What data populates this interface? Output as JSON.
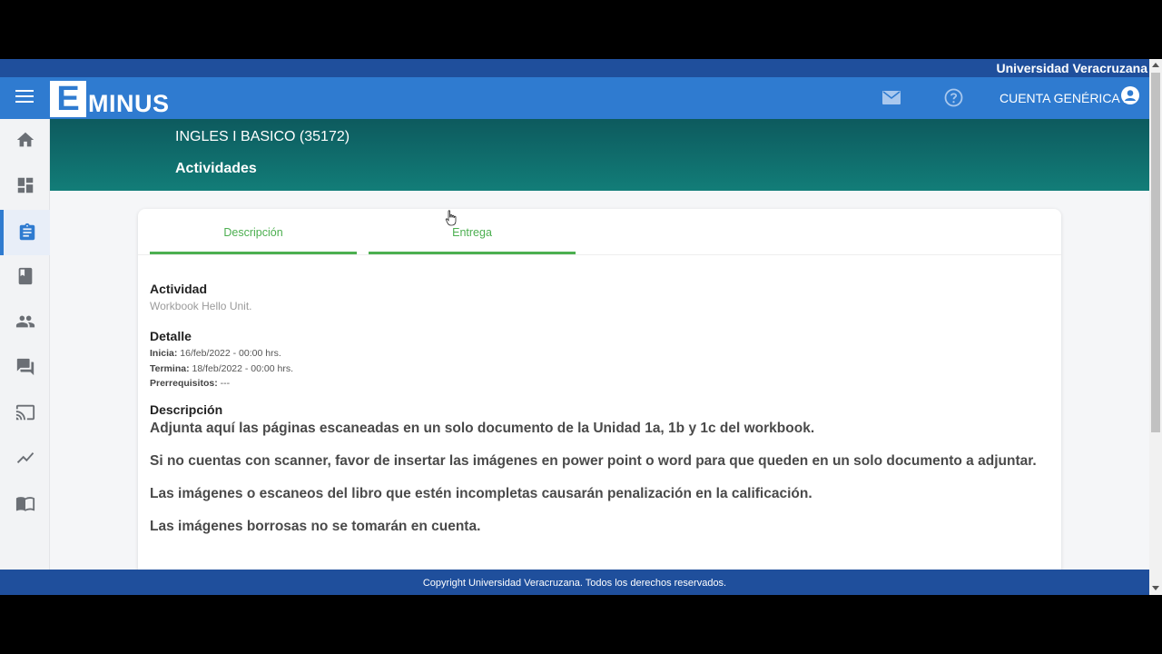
{
  "header": {
    "university": "Universidad Veracruzana",
    "logo_letter": "E",
    "logo_rest": "MINUS",
    "account_name": "CUENTA GENÉRICA 1"
  },
  "sidebar": {
    "items": [
      {
        "name": "home-icon",
        "active": false
      },
      {
        "name": "dashboard-icon",
        "active": false
      },
      {
        "name": "assignment-icon",
        "active": true
      },
      {
        "name": "book-icon",
        "active": false
      },
      {
        "name": "people-icon",
        "active": false
      },
      {
        "name": "forum-icon",
        "active": false
      },
      {
        "name": "cast-icon",
        "active": false
      },
      {
        "name": "trending-icon",
        "active": false
      },
      {
        "name": "menu-book-icon",
        "active": false
      }
    ]
  },
  "banner": {
    "course": "INGLES I BASICO (35172)",
    "section": "Actividades"
  },
  "tabs": [
    {
      "label": "Descripción"
    },
    {
      "label": "Entrega"
    }
  ],
  "activity": {
    "heading": "Actividad",
    "name": "Workbook Hello Unit."
  },
  "detail": {
    "heading": "Detalle",
    "start_label": "Inicia:",
    "start_value": " 16/feb/2022 - 00:00 hrs.",
    "end_label": "Termina:",
    "end_value": " 18/feb/2022 - 00:00 hrs.",
    "prereq_label": "Prerrequisitos:",
    "prereq_value": " ---"
  },
  "description": {
    "heading": "Descripción",
    "paragraphs": [
      "Adjunta aquí las páginas escaneadas en un solo documento de la Unidad 1a, 1b y 1c del workbook.",
      "Si no cuentas con scanner, favor de insertar las imágenes en power point o word para que queden en un solo documento a adjuntar.",
      "Las imágenes o escaneos del libro que estén incompletas causarán penalización en la calificación.",
      "Las imágenes borrosas no se tomarán en cuenta."
    ]
  },
  "footer": {
    "text": "Copyright Universidad Veracruzana. Todos los derechos reservados."
  },
  "colors": {
    "primary": "#2f7bd0",
    "dark_primary": "#1f4f9c",
    "accent": "#4caf50",
    "banner": "#127d78"
  }
}
